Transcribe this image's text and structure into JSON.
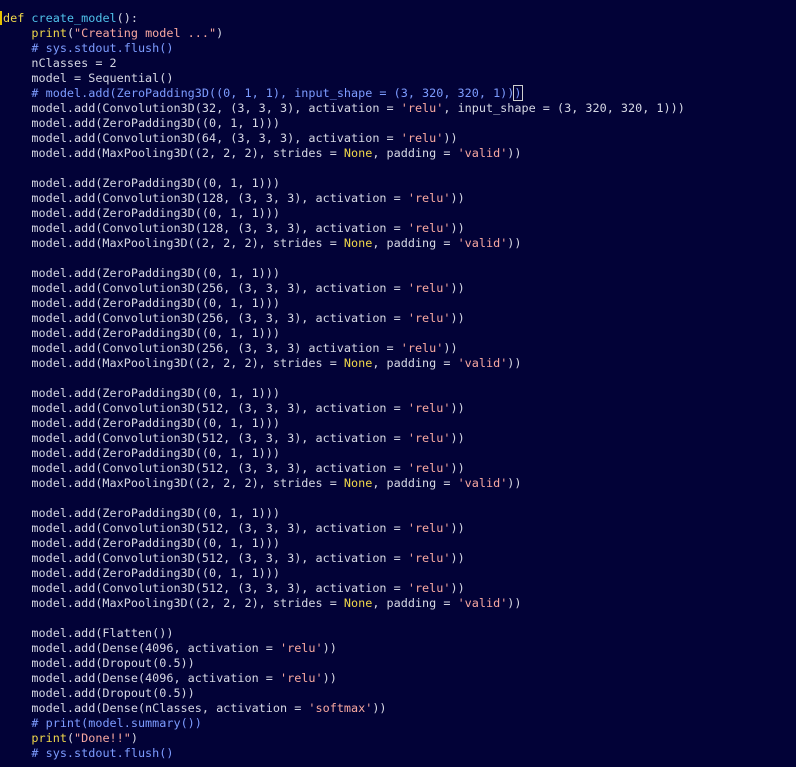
{
  "theme": {
    "background": "#020237",
    "keyword": "#f0d84a",
    "function_name": "#4fc1e9",
    "constant": "#f0d84a",
    "string": "#f8a8a0",
    "comment": "#7d9cff",
    "text": "#d6d8e4"
  },
  "editor": {
    "lines": [
      [
        {
          "t": "kw",
          "v": "def"
        },
        {
          "t": "plain",
          "v": " "
        },
        {
          "t": "fn",
          "v": "create_model"
        },
        {
          "t": "plain",
          "v": "():"
        }
      ],
      [
        {
          "t": "plain",
          "v": "    "
        },
        {
          "t": "kw",
          "v": "print"
        },
        {
          "t": "plain",
          "v": "("
        },
        {
          "t": "str",
          "v": "\"Creating model ...\""
        },
        {
          "t": "plain",
          "v": ")"
        }
      ],
      [
        {
          "t": "plain",
          "v": "    "
        },
        {
          "t": "comment",
          "v": "# sys.stdout.flush()"
        }
      ],
      [
        {
          "t": "plain",
          "v": "    nClasses = 2"
        }
      ],
      [
        {
          "t": "plain",
          "v": "    model = Sequential()"
        }
      ],
      [
        {
          "t": "plain",
          "v": "    "
        },
        {
          "t": "comment",
          "v": "# model.add(ZeroPadding3D((0, 1, 1), input_shape = (3, 320, 320, 1))"
        },
        {
          "t": "bracket",
          "v": ")"
        },
        {
          "t": "caret",
          "v": ""
        }
      ],
      [
        {
          "t": "plain",
          "v": "    model.add(Convolution3D(32, (3, 3, 3), activation = "
        },
        {
          "t": "str",
          "v": "'relu'"
        },
        {
          "t": "plain",
          "v": ", input_shape = (3, 320, 320, 1)))"
        }
      ],
      [
        {
          "t": "plain",
          "v": "    model.add(ZeroPadding3D((0, 1, 1)))"
        }
      ],
      [
        {
          "t": "plain",
          "v": "    model.add(Convolution3D(64, (3, 3, 3), activation = "
        },
        {
          "t": "str",
          "v": "'relu'"
        },
        {
          "t": "plain",
          "v": "))"
        }
      ],
      [
        {
          "t": "plain",
          "v": "    model.add(MaxPooling3D((2, 2, 2), strides = "
        },
        {
          "t": "const",
          "v": "None"
        },
        {
          "t": "plain",
          "v": ", padding = "
        },
        {
          "t": "str",
          "v": "'valid'"
        },
        {
          "t": "plain",
          "v": "))"
        }
      ],
      [],
      [
        {
          "t": "plain",
          "v": "    model.add(ZeroPadding3D((0, 1, 1)))"
        }
      ],
      [
        {
          "t": "plain",
          "v": "    model.add(Convolution3D(128, (3, 3, 3), activation = "
        },
        {
          "t": "str",
          "v": "'relu'"
        },
        {
          "t": "plain",
          "v": "))"
        }
      ],
      [
        {
          "t": "plain",
          "v": "    model.add(ZeroPadding3D((0, 1, 1)))"
        }
      ],
      [
        {
          "t": "plain",
          "v": "    model.add(Convolution3D(128, (3, 3, 3), activation = "
        },
        {
          "t": "str",
          "v": "'relu'"
        },
        {
          "t": "plain",
          "v": "))"
        }
      ],
      [
        {
          "t": "plain",
          "v": "    model.add(MaxPooling3D((2, 2, 2), strides = "
        },
        {
          "t": "const",
          "v": "None"
        },
        {
          "t": "plain",
          "v": ", padding = "
        },
        {
          "t": "str",
          "v": "'valid'"
        },
        {
          "t": "plain",
          "v": "))"
        }
      ],
      [],
      [
        {
          "t": "plain",
          "v": "    model.add(ZeroPadding3D((0, 1, 1)))"
        }
      ],
      [
        {
          "t": "plain",
          "v": "    model.add(Convolution3D(256, (3, 3, 3), activation = "
        },
        {
          "t": "str",
          "v": "'relu'"
        },
        {
          "t": "plain",
          "v": "))"
        }
      ],
      [
        {
          "t": "plain",
          "v": "    model.add(ZeroPadding3D((0, 1, 1)))"
        }
      ],
      [
        {
          "t": "plain",
          "v": "    model.add(Convolution3D(256, (3, 3, 3), activation = "
        },
        {
          "t": "str",
          "v": "'relu'"
        },
        {
          "t": "plain",
          "v": "))"
        }
      ],
      [
        {
          "t": "plain",
          "v": "    model.add(ZeroPadding3D((0, 1, 1)))"
        }
      ],
      [
        {
          "t": "plain",
          "v": "    model.add(Convolution3D(256, (3, 3, 3) activation = "
        },
        {
          "t": "str",
          "v": "'relu'"
        },
        {
          "t": "plain",
          "v": "))"
        }
      ],
      [
        {
          "t": "plain",
          "v": "    model.add(MaxPooling3D((2, 2, 2), strides = "
        },
        {
          "t": "const",
          "v": "None"
        },
        {
          "t": "plain",
          "v": ", padding = "
        },
        {
          "t": "str",
          "v": "'valid'"
        },
        {
          "t": "plain",
          "v": "))"
        }
      ],
      [],
      [
        {
          "t": "plain",
          "v": "    model.add(ZeroPadding3D((0, 1, 1)))"
        }
      ],
      [
        {
          "t": "plain",
          "v": "    model.add(Convolution3D(512, (3, 3, 3), activation = "
        },
        {
          "t": "str",
          "v": "'relu'"
        },
        {
          "t": "plain",
          "v": "))"
        }
      ],
      [
        {
          "t": "plain",
          "v": "    model.add(ZeroPadding3D((0, 1, 1)))"
        }
      ],
      [
        {
          "t": "plain",
          "v": "    model.add(Convolution3D(512, (3, 3, 3), activation = "
        },
        {
          "t": "str",
          "v": "'relu'"
        },
        {
          "t": "plain",
          "v": "))"
        }
      ],
      [
        {
          "t": "plain",
          "v": "    model.add(ZeroPadding3D((0, 1, 1)))"
        }
      ],
      [
        {
          "t": "plain",
          "v": "    model.add(Convolution3D(512, (3, 3, 3), activation = "
        },
        {
          "t": "str",
          "v": "'relu'"
        },
        {
          "t": "plain",
          "v": "))"
        }
      ],
      [
        {
          "t": "plain",
          "v": "    model.add(MaxPooling3D((2, 2, 2), strides = "
        },
        {
          "t": "const",
          "v": "None"
        },
        {
          "t": "plain",
          "v": ", padding = "
        },
        {
          "t": "str",
          "v": "'valid'"
        },
        {
          "t": "plain",
          "v": "))"
        }
      ],
      [],
      [
        {
          "t": "plain",
          "v": "    model.add(ZeroPadding3D((0, 1, 1)))"
        }
      ],
      [
        {
          "t": "plain",
          "v": "    model.add(Convolution3D(512, (3, 3, 3), activation = "
        },
        {
          "t": "str",
          "v": "'relu'"
        },
        {
          "t": "plain",
          "v": "))"
        }
      ],
      [
        {
          "t": "plain",
          "v": "    model.add(ZeroPadding3D((0, 1, 1)))"
        }
      ],
      [
        {
          "t": "plain",
          "v": "    model.add(Convolution3D(512, (3, 3, 3), activation = "
        },
        {
          "t": "str",
          "v": "'relu'"
        },
        {
          "t": "plain",
          "v": "))"
        }
      ],
      [
        {
          "t": "plain",
          "v": "    model.add(ZeroPadding3D((0, 1, 1)))"
        }
      ],
      [
        {
          "t": "plain",
          "v": "    model.add(Convolution3D(512, (3, 3, 3), activation = "
        },
        {
          "t": "str",
          "v": "'relu'"
        },
        {
          "t": "plain",
          "v": "))"
        }
      ],
      [
        {
          "t": "plain",
          "v": "    model.add(MaxPooling3D((2, 2, 2), strides = "
        },
        {
          "t": "const",
          "v": "None"
        },
        {
          "t": "plain",
          "v": ", padding = "
        },
        {
          "t": "str",
          "v": "'valid'"
        },
        {
          "t": "plain",
          "v": "))"
        }
      ],
      [],
      [
        {
          "t": "plain",
          "v": "    model.add(Flatten())"
        }
      ],
      [
        {
          "t": "plain",
          "v": "    model.add(Dense(4096, activation = "
        },
        {
          "t": "str",
          "v": "'relu'"
        },
        {
          "t": "plain",
          "v": "))"
        }
      ],
      [
        {
          "t": "plain",
          "v": "    model.add(Dropout(0.5))"
        }
      ],
      [
        {
          "t": "plain",
          "v": "    model.add(Dense(4096, activation = "
        },
        {
          "t": "str",
          "v": "'relu'"
        },
        {
          "t": "plain",
          "v": "))"
        }
      ],
      [
        {
          "t": "plain",
          "v": "    model.add(Dropout(0.5))"
        }
      ],
      [
        {
          "t": "plain",
          "v": "    model.add(Dense(nClasses, activation = "
        },
        {
          "t": "str",
          "v": "'softmax'"
        },
        {
          "t": "plain",
          "v": "))"
        }
      ],
      [
        {
          "t": "plain",
          "v": "    "
        },
        {
          "t": "comment",
          "v": "# print(model.summary())"
        }
      ],
      [
        {
          "t": "plain",
          "v": "    "
        },
        {
          "t": "kw",
          "v": "print"
        },
        {
          "t": "plain",
          "v": "("
        },
        {
          "t": "str",
          "v": "\"Done!!\""
        },
        {
          "t": "plain",
          "v": ")"
        }
      ],
      [
        {
          "t": "plain",
          "v": "    "
        },
        {
          "t": "comment",
          "v": "# sys.stdout.flush()"
        }
      ]
    ]
  }
}
